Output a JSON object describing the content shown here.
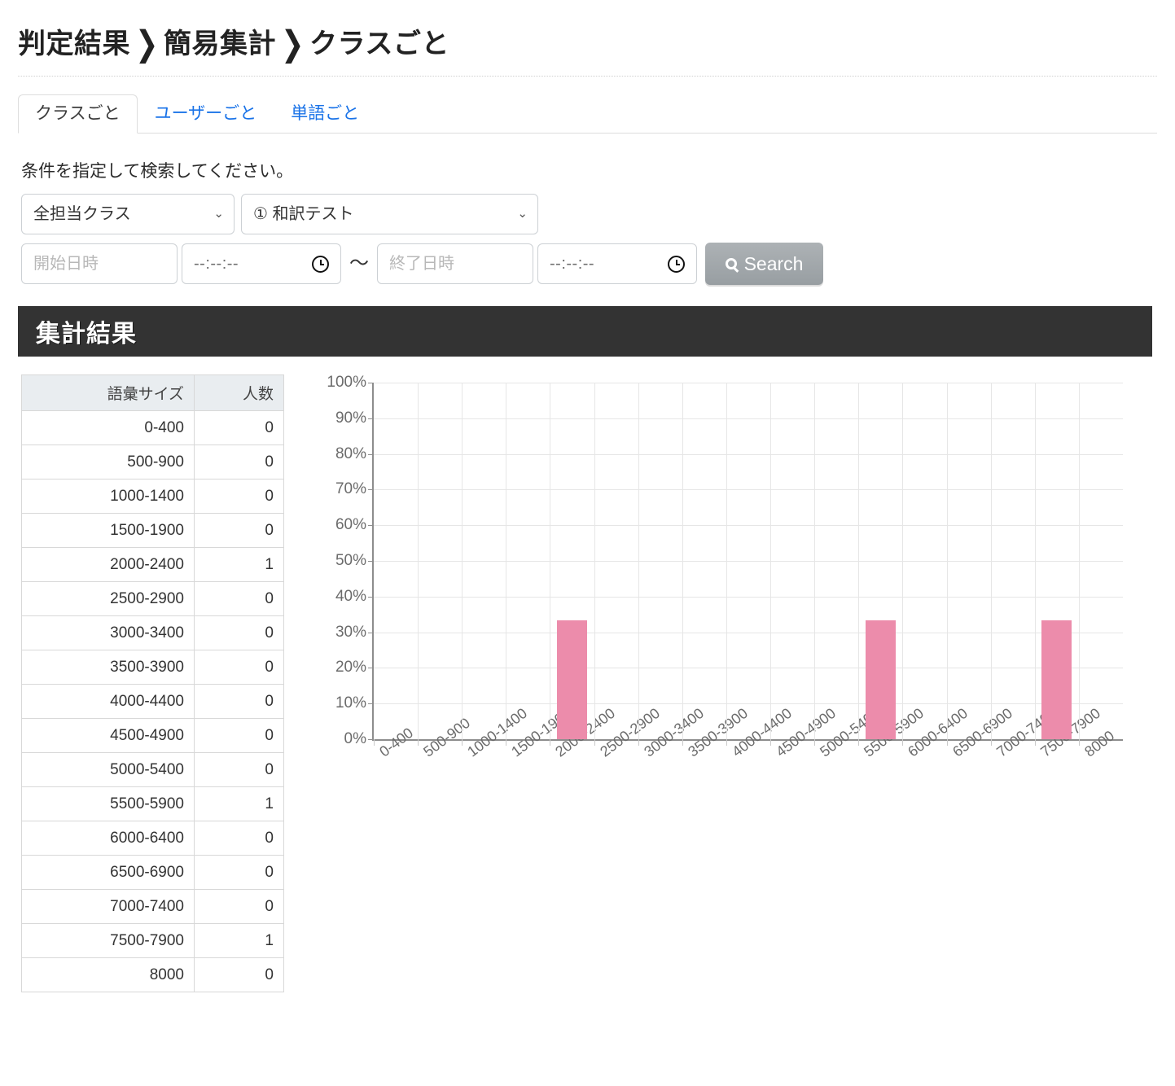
{
  "header": {
    "breadcrumb": [
      "判定結果",
      "簡易集計",
      "クラスごと"
    ],
    "separator": "❯"
  },
  "tabs": [
    {
      "label": "クラスごと",
      "active": true
    },
    {
      "label": "ユーザーごと",
      "active": false
    },
    {
      "label": "単語ごと",
      "active": false
    }
  ],
  "search": {
    "hint": "条件を指定して検索してください。",
    "class_select": {
      "value": "全担当クラス"
    },
    "test_select": {
      "value": "① 和訳テスト"
    },
    "start_date": {
      "value": "",
      "placeholder": "開始日時"
    },
    "start_time": {
      "value": "--:--:--"
    },
    "range_separator": "～",
    "end_date": {
      "value": "",
      "placeholder": "終了日時"
    },
    "end_time": {
      "value": "--:--:--"
    },
    "search_button": "Search"
  },
  "result": {
    "banner_title": "集計結果",
    "table": {
      "columns": [
        "語彙サイズ",
        "人数"
      ],
      "rows": [
        [
          "0-400",
          "0"
        ],
        [
          "500-900",
          "0"
        ],
        [
          "1000-1400",
          "0"
        ],
        [
          "1500-1900",
          "0"
        ],
        [
          "2000-2400",
          "1"
        ],
        [
          "2500-2900",
          "0"
        ],
        [
          "3000-3400",
          "0"
        ],
        [
          "3500-3900",
          "0"
        ],
        [
          "4000-4400",
          "0"
        ],
        [
          "4500-4900",
          "0"
        ],
        [
          "5000-5400",
          "0"
        ],
        [
          "5500-5900",
          "1"
        ],
        [
          "6000-6400",
          "0"
        ],
        [
          "6500-6900",
          "0"
        ],
        [
          "7000-7400",
          "0"
        ],
        [
          "7500-7900",
          "1"
        ],
        [
          "8000",
          "0"
        ]
      ]
    }
  },
  "colors": {
    "bar": "#ec8cab",
    "banner": "#333333",
    "tab_link": "#1a73e8",
    "button": "#9ba0a4"
  },
  "chart_data": {
    "type": "bar",
    "title": "",
    "xlabel": "",
    "ylabel": "",
    "categories": [
      "0-400",
      "500-900",
      "1000-1400",
      "1500-1900",
      "2000-2400",
      "2500-2900",
      "3000-3400",
      "3500-3900",
      "4000-4400",
      "4500-4900",
      "5000-5400",
      "5500-5900",
      "6000-6400",
      "6500-6900",
      "7000-7400",
      "7500-7900",
      "8000"
    ],
    "values": [
      0,
      0,
      0,
      0,
      33.3,
      0,
      0,
      0,
      0,
      0,
      0,
      33.3,
      0,
      0,
      0,
      33.3,
      0
    ],
    "ylim": [
      0,
      100
    ],
    "yticks": [
      0,
      10,
      20,
      30,
      40,
      50,
      60,
      70,
      80,
      90,
      100
    ],
    "ytick_labels": [
      "0%",
      "10%",
      "20%",
      "30%",
      "40%",
      "50%",
      "60%",
      "70%",
      "80%",
      "90%",
      "100%"
    ],
    "grid": true,
    "legend": false
  }
}
